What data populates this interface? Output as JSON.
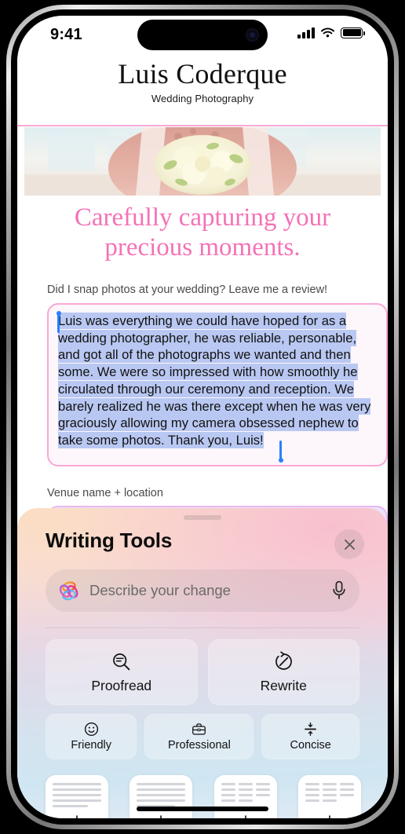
{
  "status_bar": {
    "time": "9:41",
    "signal_icon": "cellular-bars-icon",
    "wifi_icon": "wifi-icon",
    "battery_icon": "battery-full-icon"
  },
  "site": {
    "brand_name": "Luis Coderque",
    "brand_tagline": "Wedding Photography",
    "hero_alt": "bride holding white bouquet",
    "headline": "Carefully capturing your precious moments.",
    "headline_color": "#f472b6",
    "accent_color": "#f9a8d4"
  },
  "form": {
    "review_prompt": "Did I snap photos at your wedding? Leave me a review!",
    "review_text": "Luis was everything we could have hoped for as a wedding photographer, he was reliable, personable, and got all of the photographs we wanted and then some. We were so impressed with how smoothly he circulated through our ceremony and reception. We barely realized he was there except when he was very graciously allowing my camera obsessed nephew to take some photos. Thank you, Luis!",
    "review_selected": true,
    "selection_color": "#b9c8f2",
    "caret_color": "#2b7fff",
    "venue_label": "Venue name + location",
    "venue_value": ""
  },
  "writing_tools": {
    "title": "Writing Tools",
    "close_icon": "close-icon",
    "grabber_icon": "drag-handle-icon",
    "describe": {
      "placeholder": "Describe your change",
      "value": "",
      "leading_icon": "apple-intelligence-icon",
      "trailing_icon": "microphone-icon"
    },
    "actions": [
      {
        "label": "Proofread",
        "icon": "proofread-magnifier-icon"
      },
      {
        "label": "Rewrite",
        "icon": "rewrite-circular-arrow-icon"
      }
    ],
    "tones": [
      {
        "label": "Friendly",
        "icon": "smiley-face-icon"
      },
      {
        "label": "Professional",
        "icon": "briefcase-icon"
      },
      {
        "label": "Concise",
        "icon": "compress-icon"
      }
    ],
    "doc_cards": [
      {
        "name": "summary-card",
        "style": "full-lines",
        "icon": "download-arrow-icon"
      },
      {
        "name": "key-points-card",
        "style": "full-lines",
        "icon": "download-arrow-icon"
      },
      {
        "name": "list-card",
        "style": "segmented-lines",
        "icon": "download-arrow-icon"
      },
      {
        "name": "table-card",
        "style": "segmented-lines",
        "icon": "download-arrow-icon"
      }
    ]
  }
}
